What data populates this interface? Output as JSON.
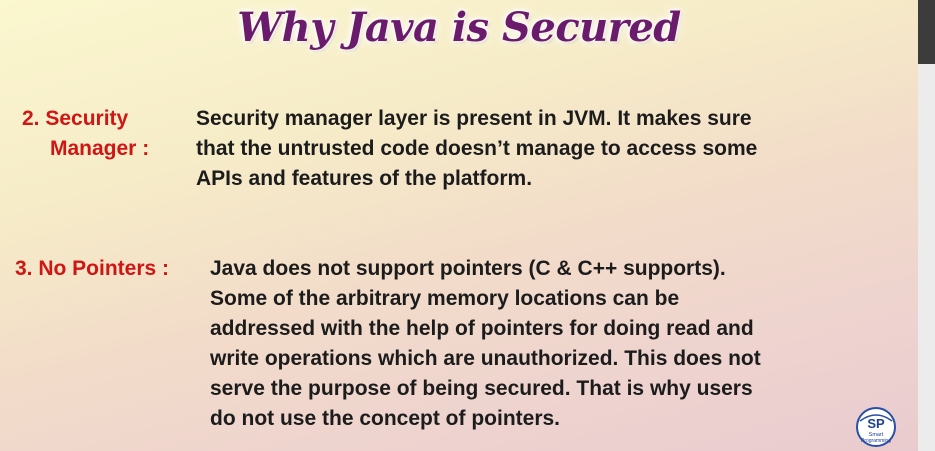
{
  "slide": {
    "title": "Why Java is Secured",
    "points": [
      {
        "label_lines": [
          "2. Security",
          "Manager :"
        ],
        "text_lines": [
          "Security manager layer is present in JVM. It makes sure",
          "that the untrusted code doesn’t manage to access some",
          "APIs and features of the platform."
        ]
      },
      {
        "label": "3. No Pointers :",
        "text_lines": [
          "Java does not support pointers (C & C++ supports).",
          "Some of the arbitrary memory locations can be",
          "addressed with the help of pointers for doing read and",
          "write operations which are unauthorized. This does not",
          "serve the purpose of being secured. That is why users",
          "do not use the concept of pointers."
        ]
      }
    ],
    "logo": {
      "monogram": "SP",
      "text_lines": [
        "Smart",
        "Programming"
      ]
    },
    "colors": {
      "title": "#6b1b6b",
      "label": "#d01515",
      "body_text": "#1c1c1c"
    }
  }
}
